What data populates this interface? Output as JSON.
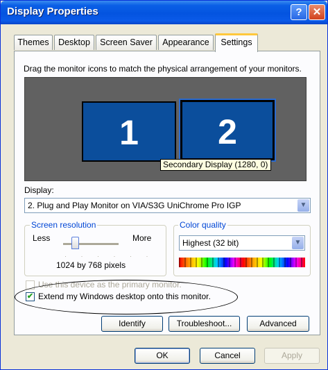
{
  "window": {
    "title": "Display Properties",
    "help_glyph": "?",
    "close_glyph": "✕"
  },
  "tabs": [
    {
      "label": "Themes"
    },
    {
      "label": "Desktop"
    },
    {
      "label": "Screen Saver"
    },
    {
      "label": "Appearance"
    },
    {
      "label": "Settings",
      "active": true
    }
  ],
  "settings": {
    "instruction": "Drag the monitor icons to match the physical arrangement of your monitors.",
    "monitors": [
      {
        "number": "1"
      },
      {
        "number": "2",
        "selected": true
      }
    ],
    "tooltip": "Secondary Display (1280, 0)",
    "display_label": "Display:",
    "display_value": "2. Plug and Play Monitor on VIA/S3G UniChrome Pro IGP",
    "resolution": {
      "group_title": "Screen resolution",
      "less": "Less",
      "more": "More",
      "value": "1024 by 768 pixels"
    },
    "color_quality": {
      "group_title": "Color quality",
      "value": "Highest (32 bit)"
    },
    "primary_checkbox": {
      "label": "Use this device as the primary monitor.",
      "checked": false,
      "enabled": false
    },
    "extend_checkbox": {
      "label": "Extend my Windows desktop onto this monitor.",
      "checked": true,
      "enabled": true
    },
    "identify_label": "Identify",
    "troubleshoot_label": "Troubleshoot...",
    "advanced_label": "Advanced"
  },
  "dialog_buttons": {
    "ok": "OK",
    "cancel": "Cancel",
    "apply": "Apply"
  },
  "colors": {
    "titlebar": "#0454E0",
    "monitor_fill": "#0B4E9C",
    "dialog_bg": "#ECE9D8"
  }
}
